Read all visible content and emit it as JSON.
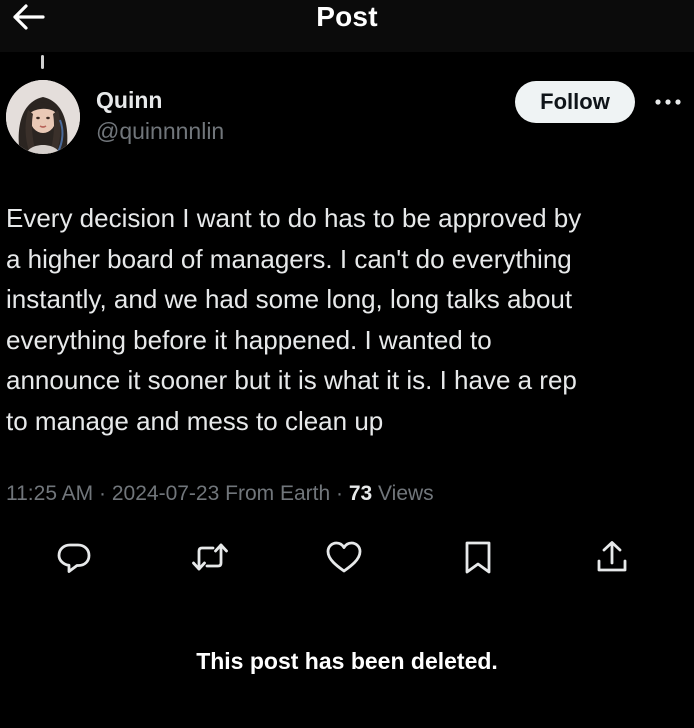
{
  "header": {
    "title": "Post",
    "back_icon": "arrow-left-icon"
  },
  "author": {
    "display_name": "Quinn",
    "handle": "@quinnnnlin",
    "avatar": "user-avatar"
  },
  "follow_button": {
    "label": "Follow"
  },
  "more_icon": "more-horizontal-icon",
  "post": {
    "lines": [
      "Every decision I want to do has to be approved by",
      "a higher board of managers. I can't do everything",
      "instantly, and we had some long, long talks about",
      "everything before it happened. I wanted to",
      "announce it sooner but it is what it is. I have a rep",
      "to manage and mess to clean up"
    ]
  },
  "meta": {
    "time": "11:25 AM",
    "date": "2024-07-23",
    "source": "From Earth",
    "separator": "·",
    "views_count": "73",
    "views_label": "Views"
  },
  "actions": [
    {
      "name": "reply",
      "icon": "reply-icon"
    },
    {
      "name": "repost",
      "icon": "repost-icon"
    },
    {
      "name": "like",
      "icon": "heart-icon"
    },
    {
      "name": "bookmark",
      "icon": "bookmark-icon"
    },
    {
      "name": "share",
      "icon": "share-icon"
    }
  ],
  "notice": {
    "text": "This post has been deleted."
  },
  "colors": {
    "background": "#000000",
    "text_primary": "#e7e9ea",
    "text_secondary": "#71767b",
    "follow_bg": "#eff3f4",
    "follow_text": "#0f1419"
  }
}
